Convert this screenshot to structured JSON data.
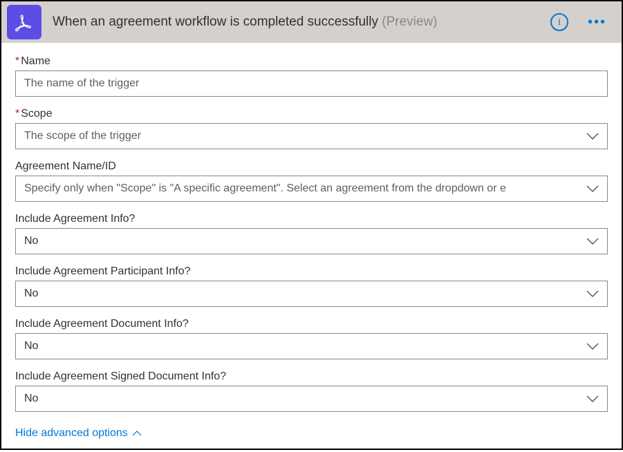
{
  "header": {
    "title": "When an agreement workflow is completed successfully",
    "preview": "(Preview)"
  },
  "fields": {
    "name": {
      "label": "Name",
      "required": true,
      "placeholder": "The name of the trigger"
    },
    "scope": {
      "label": "Scope",
      "required": true,
      "placeholder": "The scope of the trigger"
    },
    "agreement_id": {
      "label": "Agreement Name/ID",
      "required": false,
      "placeholder": "Specify only when \"Scope\" is \"A specific agreement\". Select an agreement from the dropdown or e"
    },
    "include_agreement_info": {
      "label": "Include Agreement Info?",
      "required": false,
      "value": "No"
    },
    "include_participant_info": {
      "label": "Include Agreement Participant Info?",
      "required": false,
      "value": "No"
    },
    "include_document_info": {
      "label": "Include Agreement Document Info?",
      "required": false,
      "value": "No"
    },
    "include_signed_document_info": {
      "label": "Include Agreement Signed Document Info?",
      "required": false,
      "value": "No"
    }
  },
  "toggle": {
    "label": "Hide advanced options"
  }
}
